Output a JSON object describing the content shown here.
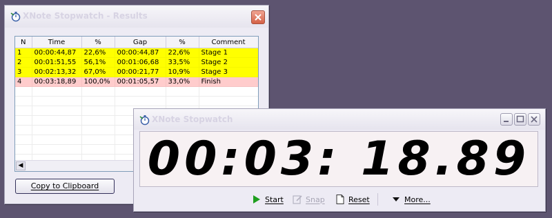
{
  "results_window": {
    "title": "XNote Stopwatch - Results",
    "columns": [
      "N",
      "Time",
      "%",
      "Gap",
      "%",
      "Comment"
    ],
    "rows": [
      {
        "n": "1",
        "time": "00:00:44,87",
        "pct": "22,6%",
        "gap": "00:00:44,87",
        "gap_pct": "22,6%",
        "comment": "Stage 1"
      },
      {
        "n": "2",
        "time": "00:01:51,55",
        "pct": "56,1%",
        "gap": "00:01:06,68",
        "gap_pct": "33,5%",
        "comment": "Stage 2"
      },
      {
        "n": "3",
        "time": "00:02:13,32",
        "pct": "67,0%",
        "gap": "00:00:21,77",
        "gap_pct": "10,9%",
        "comment": "Stage 3"
      },
      {
        "n": "4",
        "time": "00:03:18,89",
        "pct": "100,0%",
        "gap": "00:01:05,57",
        "gap_pct": "33,0%",
        "comment": "Finish"
      }
    ],
    "copy_button": "Copy to Clipboard"
  },
  "stopwatch_window": {
    "title": "XNote Stopwatch",
    "display": "00:03: 18.89",
    "toolbar": {
      "start": "Start",
      "snap": "Snap",
      "reset": "Reset",
      "more": "More..."
    }
  },
  "colors": {
    "desktop": "#5d5470",
    "stage_row": "#ffff00",
    "finish_row": "#ffcccc",
    "start_icon": "#1e9e1e"
  },
  "icons": [
    "stopwatch-app-icon",
    "close-icon",
    "minimize-icon",
    "maximize-icon",
    "play-icon",
    "snap-icon",
    "page-icon",
    "caret-down-icon",
    "scroll-left-arrow-icon"
  ]
}
